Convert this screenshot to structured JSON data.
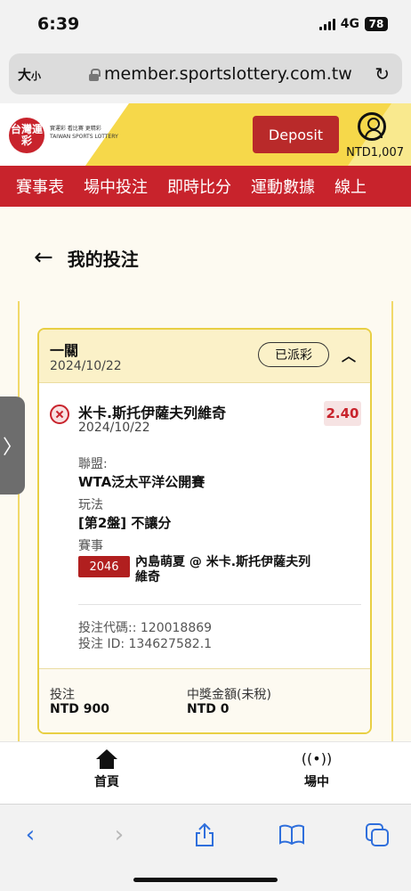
{
  "status": {
    "time": "6:39",
    "network": "4G",
    "battery": "78"
  },
  "browser": {
    "text_size_label": "大",
    "text_size_small": "小",
    "url": "member.sportslottery.com.tw"
  },
  "header": {
    "logo_text": "台灣運彩",
    "logo_sub_line1": "實運彩 看比賽 更精彩",
    "logo_sub_line2": "TAIWAN SPORTS LOTTERY",
    "deposit_label": "Deposit",
    "balance": "NTD1,007"
  },
  "nav": {
    "items": [
      "賽事表",
      "場中投注",
      "即時比分",
      "運動數據",
      "線上"
    ]
  },
  "page": {
    "back_arrow": "←",
    "title": "我的投注"
  },
  "bet": {
    "type": "一關",
    "date": "2024/10/22",
    "status": "已派彩",
    "selection": {
      "name": "米卡.斯托伊薩夫列維奇",
      "date": "2024/10/22",
      "odds": "2.40",
      "league_label": "聯盟:",
      "league": "WTA泛太平洋公開賽",
      "market_label": "玩法",
      "market": "[第2盤] 不讓分",
      "event_label": "賽事",
      "event_code": "2046",
      "event_name": "內島萌夏 @ 米卡.斯托伊薩夫列維奇"
    },
    "bet_code": "投注代碼:: 120018869",
    "bet_id": "投注 ID: 134627582.1",
    "stake_label": "投注",
    "stake": "NTD 900",
    "payout_label": "中獎金額(未稅)",
    "payout": "NTD 0"
  },
  "appnav": {
    "home": "首頁",
    "live": "場中"
  }
}
